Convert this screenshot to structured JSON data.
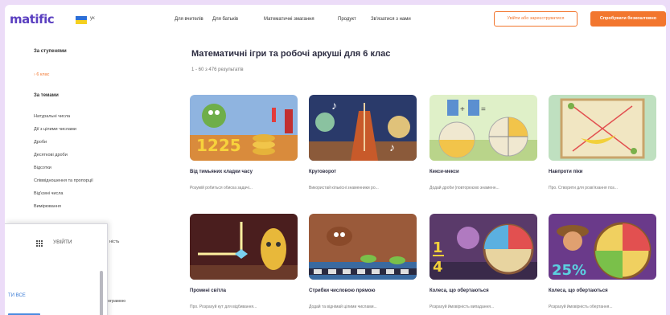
{
  "header": {
    "logo": "matific",
    "lang": "ук",
    "nav": [
      "Для вчителів",
      "Для батьків",
      "Математичні змагання",
      "Продукт",
      "Зв'язатися з нами"
    ],
    "btn_outline": "Увійти або зареєструватися",
    "btn_solid": "Спробувати безкоштовно"
  },
  "sidebar": {
    "by_grade_head": "За ступенями",
    "grade_active": "› 6 клас",
    "by_topic_head": "За темами",
    "topics": [
      "Натуральні числа",
      "Дії з цілими числами",
      "Дроби",
      "Десяткові дроби",
      "Відсотки",
      "Співвідношення та пропорції",
      "Від'ємні числа",
      "Вимірювання"
    ],
    "partial_1": "ність",
    "partial_2": "к програмою"
  },
  "main": {
    "title": "Математичні ігри та робочі аркуші для 6 клас",
    "subtitle": "1 - 60 з 476 результатів",
    "cards": [
      {
        "title": "Від тимьяних кладки часу",
        "desc": "Розумій робиться обиска задачі..."
      },
      {
        "title": "Круговорот",
        "desc": "Використай кількісні знаменники ро..."
      },
      {
        "title": "Кекси-мекси",
        "desc": "Додай дроби (повторюємо знаменн..."
      },
      {
        "title": "Навпроти піки",
        "desc": "Про. Створити для розв'язання поз..."
      },
      {
        "title": "Промені світла",
        "desc": "Про. Розрахуй кут для відбивання..."
      },
      {
        "title": "Стрибки числовою прямою",
        "desc": "Додай та віднімай цілими числами..."
      },
      {
        "title": "Колеса, що обертаються",
        "desc": "Розрахуй ймовірність випадання..."
      },
      {
        "title": "Колеса, що обертаються",
        "desc": "Розрахуй ймовірність обертання..."
      }
    ]
  },
  "popup": {
    "login": "УВІЙТИ",
    "all": "ТИ ВСЕ"
  },
  "colors": {
    "accent": "#f2762e",
    "brand": "#5a3fc0",
    "frame": "#ecdcf8"
  }
}
